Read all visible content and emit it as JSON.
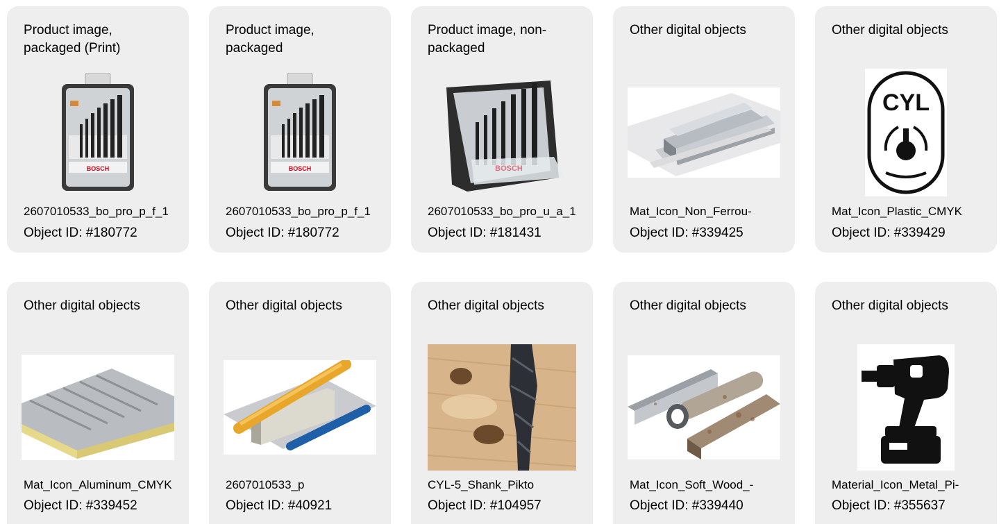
{
  "cards": [
    {
      "category": "Product image, packaged (Print)",
      "filename": "2607010533_bo_pro_p_f_1",
      "object_id": "Object ID: #180772",
      "image": "drill-bit-set-packaged",
      "brand_text": "BOSCH"
    },
    {
      "category": "Product image, packaged",
      "filename": "2607010533_bo_pro_p_f_1",
      "object_id": "Object ID: #180772",
      "image": "drill-bit-set-packaged",
      "brand_text": "BOSCH"
    },
    {
      "category": "Product image, non-packaged",
      "filename": "2607010533_bo_pro_u_a_1",
      "object_id": "Object ID: #181431",
      "image": "drill-bit-set-open-case",
      "brand_text": "BOSCH"
    },
    {
      "category": "Other digital objects",
      "filename": "Mat_Icon_Non_Ferrou-",
      "object_id": "Object ID: #339425",
      "image": "aluminum-profile"
    },
    {
      "category": "Other digital objects",
      "filename": "Mat_Icon_Plastic_CMYK",
      "object_id": "Object ID: #339429",
      "image": "cyl-shank-pictogram",
      "badge_text": "CYL"
    },
    {
      "category": "Other digital objects",
      "filename": "Mat_Icon_Aluminum_CMYK",
      "object_id": "Object ID: #339452",
      "image": "sandwich-panel"
    },
    {
      "category": "Other digital objects",
      "filename": "2607010533_p",
      "object_id": "Object ID: #40921",
      "image": "plastic-pipes"
    },
    {
      "category": "Other digital objects",
      "filename": "CYL-5_Shank_Pikto",
      "object_id": "Object ID: #104957",
      "image": "drill-in-wood"
    },
    {
      "category": "Other digital objects",
      "filename": "Mat_Icon_Soft_Wood_-",
      "object_id": "Object ID: #339440",
      "image": "steel-profiles"
    },
    {
      "category": "Other digital objects",
      "filename": "Material_Icon_Metal_Pi-",
      "object_id": "Object ID: #355637",
      "image": "cordless-drill-pictogram"
    }
  ]
}
